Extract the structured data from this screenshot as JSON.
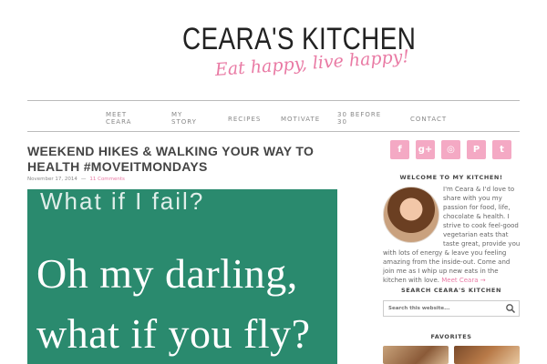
{
  "header": {
    "title": "Ceara's Kitchen",
    "title_display": "CEARA'S KITCHEN",
    "tagline": "Eat happy, live happy!"
  },
  "nav": {
    "items": [
      {
        "line1": "MEET",
        "line2": "CEARA"
      },
      {
        "line1": "MY",
        "line2": "STORY"
      },
      {
        "line1": "RECIPES",
        "line2": ""
      },
      {
        "line1": "MOTIVATE",
        "line2": ""
      },
      {
        "line1": "30 BEFORE",
        "line2": "30"
      },
      {
        "line1": "CONTACT",
        "line2": ""
      }
    ]
  },
  "post": {
    "title": "Weekend Hikes & Walking Your Way to Health #MoveItMondays",
    "date": "November 17, 2014",
    "separator": "—",
    "comments": "11 Comments",
    "image_text": {
      "line1": "What if I fail?",
      "line2": "Oh my darling,",
      "line3": "what if you fly?"
    },
    "image_bg": "#2a8a6e"
  },
  "sidebar": {
    "social": [
      {
        "icon": "facebook-icon",
        "glyph": "f"
      },
      {
        "icon": "google-plus-icon",
        "glyph": "g+"
      },
      {
        "icon": "instagram-icon",
        "glyph": "◎"
      },
      {
        "icon": "pinterest-icon",
        "glyph": "P"
      },
      {
        "icon": "twitter-icon",
        "glyph": "t"
      }
    ],
    "social_color": "#f4a9c4",
    "welcome": {
      "title": "Welcome to my Kitchen!",
      "text_a": "I'm Ceara & I'd love to share with you my passion for food, life, chocolate & health. I strive to cook feel-good vegetarian eats that taste great, provide you",
      "text_b": "with lots of energy & leave you feeling amazing from the inside-out. Come and join me as I whip up new eats in the kitchen with love.",
      "link": "Meet Ceara →"
    },
    "search": {
      "title": "Search Ceara's Kitchen",
      "placeholder": "Search this website..."
    },
    "favorites": {
      "title": "Favorites"
    }
  },
  "colors": {
    "accent": "#e97aa4",
    "nav_text": "#888888",
    "title_text": "#444444"
  }
}
